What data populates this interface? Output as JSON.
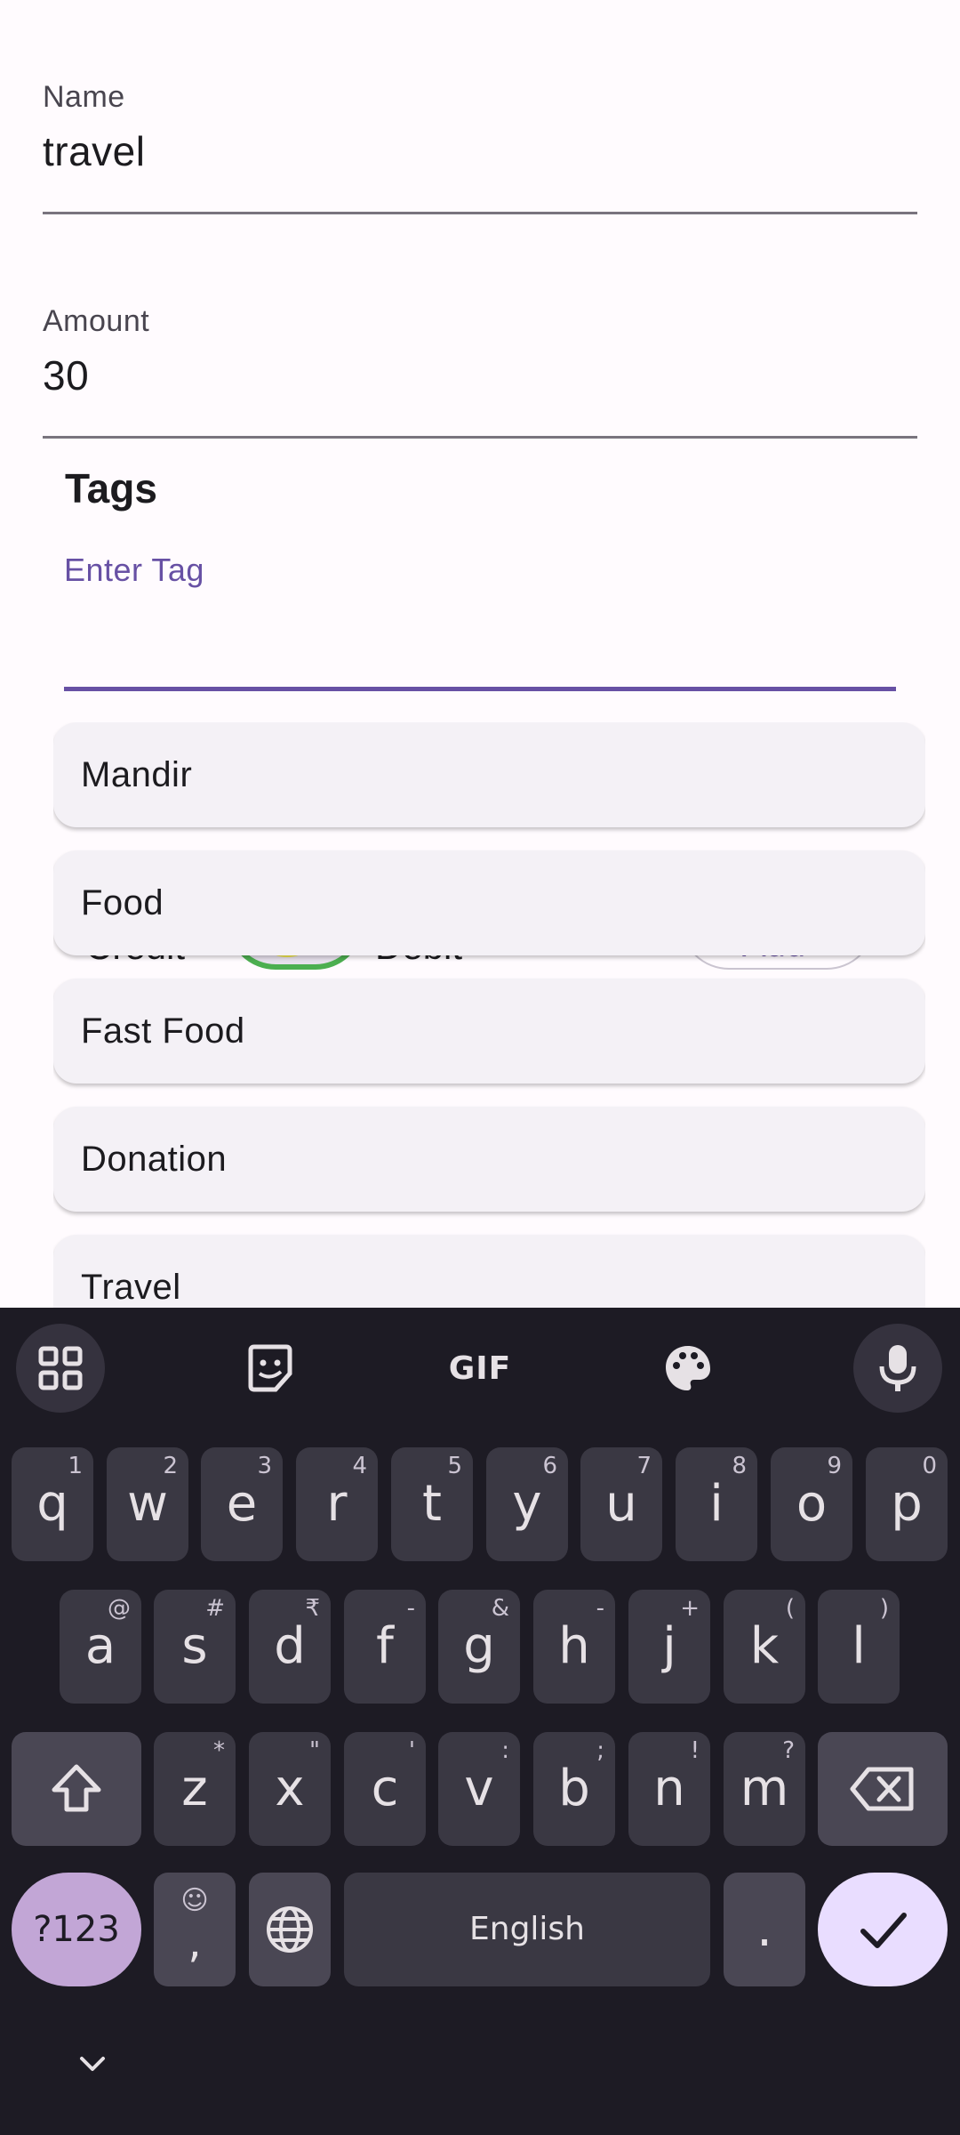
{
  "form": {
    "name_label": "Name",
    "name_value": "travel",
    "amount_label": "Amount",
    "amount_value": "30",
    "tags_title": "Tags",
    "tag_placeholder": "Enter Tag"
  },
  "hidden_row": {
    "credit_label": "Credit",
    "debit_label": "Debit",
    "add_label": "Add"
  },
  "suggestions": [
    "Mandir",
    "Food",
    "Fast Food",
    "Donation",
    "Travel"
  ],
  "keyboard": {
    "toolbar": {
      "apps_icon": "grid-icon",
      "sticker_icon": "sticker-icon",
      "gif_label": "GIF",
      "theme_icon": "palette-icon",
      "mic_icon": "microphone-icon"
    },
    "row1": [
      {
        "k": "q",
        "h": "1"
      },
      {
        "k": "w",
        "h": "2"
      },
      {
        "k": "e",
        "h": "3"
      },
      {
        "k": "r",
        "h": "4"
      },
      {
        "k": "t",
        "h": "5"
      },
      {
        "k": "y",
        "h": "6"
      },
      {
        "k": "u",
        "h": "7"
      },
      {
        "k": "i",
        "h": "8"
      },
      {
        "k": "o",
        "h": "9"
      },
      {
        "k": "p",
        "h": "0"
      }
    ],
    "row2": [
      {
        "k": "a",
        "h": "@"
      },
      {
        "k": "s",
        "h": "#"
      },
      {
        "k": "d",
        "h": "₹"
      },
      {
        "k": "f",
        "h": "-"
      },
      {
        "k": "g",
        "h": "&"
      },
      {
        "k": "h",
        "h": "-"
      },
      {
        "k": "j",
        "h": "+"
      },
      {
        "k": "k",
        "h": "("
      },
      {
        "k": "l",
        "h": ")"
      }
    ],
    "row3": [
      {
        "k": "z",
        "h": "*"
      },
      {
        "k": "x",
        "h": "\""
      },
      {
        "k": "c",
        "h": "'"
      },
      {
        "k": "v",
        "h": ":"
      },
      {
        "k": "b",
        "h": ";"
      },
      {
        "k": "n",
        "h": "!"
      },
      {
        "k": "m",
        "h": "?"
      }
    ],
    "symbols_label": "?123",
    "comma_label": ",",
    "comma_hint": "☺",
    "space_label": "English",
    "period_label": ".",
    "shift_icon": "shift-icon",
    "backspace_icon": "backspace-icon",
    "globe_icon": "globe-icon",
    "done_icon": "checkmark-icon"
  },
  "colors": {
    "accent": "#6750a4",
    "keyboard_bg": "#1d1b24",
    "key_bg": "#3a3843",
    "symbols_key": "#c2a6d6",
    "done_key": "#e9ddff"
  }
}
